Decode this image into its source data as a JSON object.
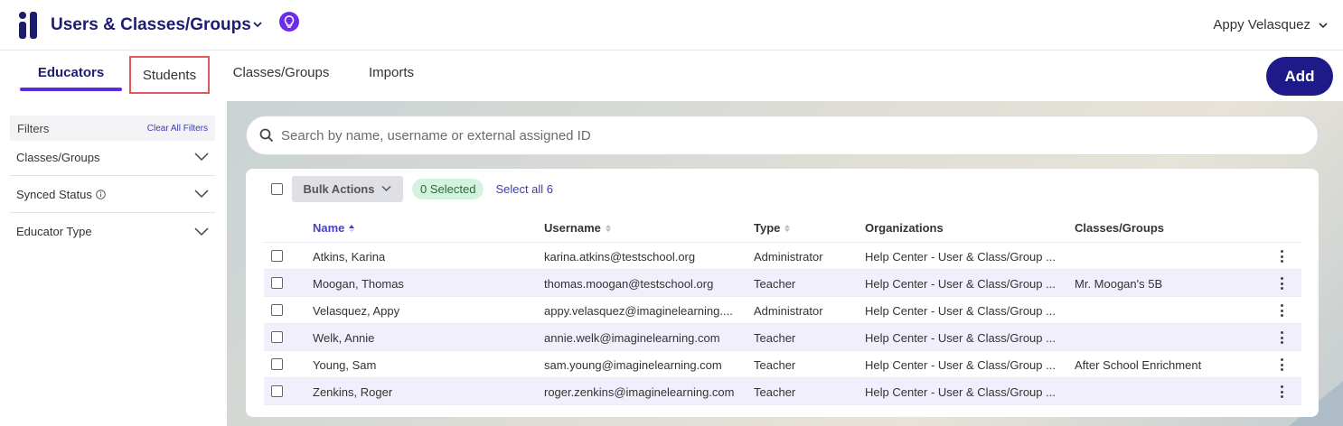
{
  "header": {
    "title": "Users & Classes/Groups",
    "user_name": "Appy Velasquez"
  },
  "tabs": [
    {
      "label": "Educators",
      "active": true
    },
    {
      "label": "Students",
      "active": false
    },
    {
      "label": "Classes/Groups",
      "active": false
    },
    {
      "label": "Imports",
      "active": false
    }
  ],
  "add_label": "Add",
  "sidebar": {
    "filters_label": "Filters",
    "clear_label": "Clear All Filters",
    "filters": [
      {
        "label": "Classes/Groups"
      },
      {
        "label": "Synced Status"
      },
      {
        "label": "Educator Type"
      }
    ]
  },
  "search": {
    "placeholder": "Search by name, username or external assigned ID"
  },
  "toolbar": {
    "bulk_label": "Bulk Actions",
    "selected_label": "0 Selected",
    "select_all_label": "Select all 6"
  },
  "table": {
    "columns": [
      "Name",
      "Username",
      "Type",
      "Organizations",
      "Classes/Groups"
    ],
    "rows": [
      {
        "name": "Atkins, Karina",
        "username": "karina.atkins@testschool.org",
        "type": "Administrator",
        "org": "Help Center - User & Class/Group ...",
        "classes": ""
      },
      {
        "name": "Moogan, Thomas",
        "username": "thomas.moogan@testschool.org",
        "type": "Teacher",
        "org": "Help Center - User & Class/Group ...",
        "classes": "Mr. Moogan's 5B"
      },
      {
        "name": "Velasquez, Appy",
        "username": "appy.velasquez@imaginelearning....",
        "type": "Administrator",
        "org": "Help Center - User & Class/Group ...",
        "classes": ""
      },
      {
        "name": "Welk, Annie",
        "username": "annie.welk@imaginelearning.com",
        "type": "Teacher",
        "org": "Help Center - User & Class/Group ...",
        "classes": ""
      },
      {
        "name": "Young, Sam",
        "username": "sam.young@imaginelearning.com",
        "type": "Teacher",
        "org": "Help Center - User & Class/Group ...",
        "classes": "After School Enrichment"
      },
      {
        "name": "Zenkins, Roger",
        "username": "roger.zenkins@imaginelearning.com",
        "type": "Teacher",
        "org": "Help Center - User & Class/Group ...",
        "classes": ""
      }
    ]
  },
  "colors": {
    "brand": "#1f1c73",
    "accent": "#5b2be0",
    "add_button": "#1e1a8a"
  }
}
